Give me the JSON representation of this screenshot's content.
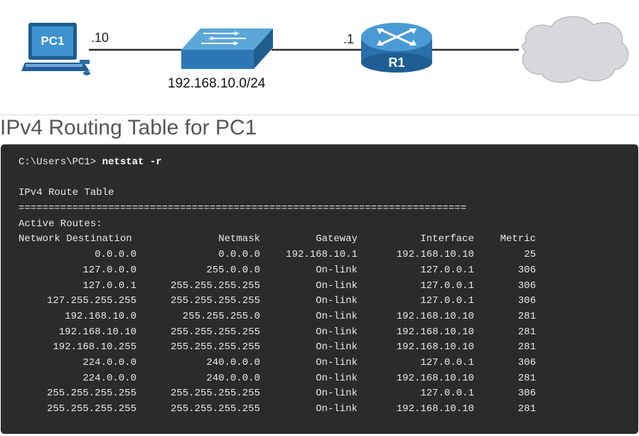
{
  "topology": {
    "pc_label": "PC1",
    "pc_ip": ".10",
    "network": "192.168.10.0/24",
    "router_ip": ".1",
    "router_label": "R1"
  },
  "section_title": "IPv4 Routing Table for PC1",
  "terminal": {
    "prompt": "C:\\Users\\PC1> ",
    "command": "netstat -r",
    "table_title": "IPv4 Route Table",
    "separator": "===========================================================================",
    "active_routes": "Active Routes:",
    "headers": [
      "Network Destination",
      "Netmask",
      "Gateway",
      "Interface",
      "Metric"
    ],
    "rows": [
      [
        "0.0.0.0",
        "0.0.0.0",
        "192.168.10.1",
        "192.168.10.10",
        "25"
      ],
      [
        "127.0.0.0",
        "255.0.0.0",
        "On-link",
        "127.0.0.1",
        "306"
      ],
      [
        "127.0.0.1",
        "255.255.255.255",
        "On-link",
        "127.0.0.1",
        "306"
      ],
      [
        "127.255.255.255",
        "255.255.255.255",
        "On-link",
        "127.0.0.1",
        "306"
      ],
      [
        "192.168.10.0",
        "255.255.255.0",
        "On-link",
        "192.168.10.10",
        "281"
      ],
      [
        "192.168.10.10",
        "255.255.255.255",
        "On-link",
        "192.168.10.10",
        "281"
      ],
      [
        "192.168.10.255",
        "255.255.255.255",
        "On-link",
        "192.168.10.10",
        "281"
      ],
      [
        "224.0.0.0",
        "240.0.0.0",
        "On-link",
        "127.0.0.1",
        "306"
      ],
      [
        "224.0.0.0",
        "240.0.0.0",
        "On-link",
        "192.168.10.10",
        "281"
      ],
      [
        "255.255.255.255",
        "255.255.255.255",
        "On-link",
        "127.0.0.1",
        "306"
      ],
      [
        "255.255.255.255",
        "255.255.255.255",
        "On-link",
        "192.168.10.10",
        "281"
      ]
    ]
  },
  "colors": {
    "device_blue": "#2a7cb8",
    "terminal_bg": "#2b2b2b",
    "cloud": "#d6d8dc"
  }
}
